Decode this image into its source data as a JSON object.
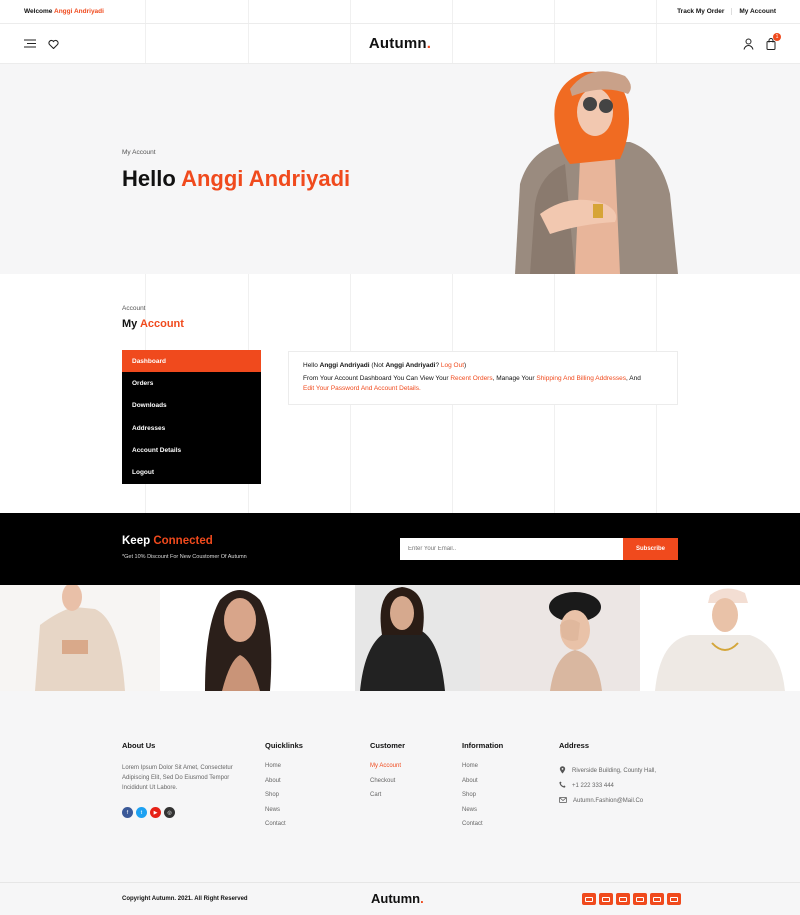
{
  "colors": {
    "accent": "#f04a1d",
    "dark": "#000000",
    "light_bg": "#f6f6f7"
  },
  "topbar": {
    "welcome": "Welcome",
    "user": "Anggi Andriyadi",
    "links": [
      "Track My Order",
      "My Account"
    ]
  },
  "header": {
    "logo": "Autumn",
    "logo_dot": ".",
    "cart_count": "1",
    "icons": [
      "menu-icon",
      "heart-icon",
      "user-icon",
      "bag-icon"
    ]
  },
  "hero": {
    "breadcrumb": "My Account",
    "greeting": "Hello",
    "name": "Anggi Andriyadi"
  },
  "account": {
    "label": "Account",
    "title_plain": "My",
    "title_accent": "Account",
    "menu": [
      "Dashboard",
      "Orders",
      "Downloads",
      "Addresses",
      "Account Details",
      "Logout"
    ],
    "dashboard": {
      "hello": "Hello",
      "name": "Anggi Andriyadi",
      "not": "(Not",
      "not_name": "Anggi Andriyadi",
      "q": "?",
      "logout": "Log Out",
      "close": ")",
      "line2_a": "From Your Account Dashboard You Can View Your",
      "recent_orders": "Recent Orders",
      "line2_b": ", Manage Your",
      "shipping": "Shipping And Billing Addresses",
      "line2_c": ", And",
      "edit": "Edit Your Password And Account Details."
    }
  },
  "newsletter": {
    "title_plain": "Keep",
    "title_accent": "Connected",
    "subtitle": "*Get 10% Discount For New Coustomer Of Autumn",
    "placeholder": "Enter Your Email..",
    "button": "Subscribe"
  },
  "footer": {
    "about": {
      "title": "About Us",
      "text": "Lorem Ipsum Dolor Sit Amet, Consectetur Adipiscing Elit, Sed Do Eiusmod Tempor Incididunt Ut Labore.",
      "socials": [
        "facebook-icon",
        "twitter-icon",
        "youtube-icon",
        "instagram-icon"
      ]
    },
    "quicklinks": {
      "title": "Quicklinks",
      "items": [
        "Home",
        "About",
        "Shop",
        "News",
        "Contact"
      ]
    },
    "customer": {
      "title": "Customer",
      "items": [
        "My Account",
        "Checkout",
        "Cart"
      ]
    },
    "information": {
      "title": "Information",
      "items": [
        "Home",
        "About",
        "Shop",
        "News",
        "Contact"
      ]
    },
    "address": {
      "title": "Address",
      "location": "Riverside Building, County Hall,",
      "phone": "+1 222 333 444",
      "email": "Autumn.Fashion@Mail.Co"
    }
  },
  "bottom": {
    "copyright": "Copyright Autumn. 2021. All Right Reserved",
    "logo": "Autumn",
    "logo_dot": "."
  }
}
